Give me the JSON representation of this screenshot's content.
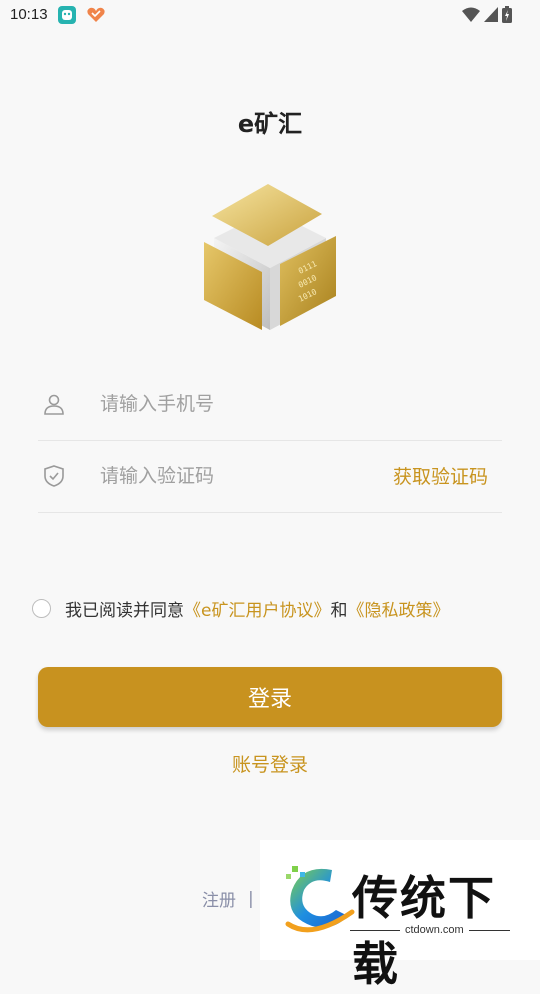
{
  "status_bar": {
    "time": "10:13",
    "icons": [
      "notification-app-icon",
      "heart-app-icon",
      "wifi-icon",
      "signal-icon",
      "battery-icon"
    ]
  },
  "header": {
    "title": "e矿汇"
  },
  "form": {
    "phone_placeholder": "请输入手机号",
    "code_placeholder": "请输入验证码",
    "get_code_label": "获取验证码"
  },
  "agreement": {
    "prefix": "我已阅读并同意",
    "user_agreement": "《e矿汇用户协议》",
    "conjunction": "和",
    "privacy_policy": "《隐私政策》"
  },
  "actions": {
    "login_label": "登录",
    "account_login_label": "账号登录"
  },
  "footer": {
    "register_label": "注册",
    "divider": "|"
  },
  "watermark": {
    "name": "传统下载",
    "url": "ctdown.com"
  },
  "colors": {
    "accent": "#c8921f",
    "link_gold": "#c8941f",
    "background": "#f8f8f8",
    "footer_link": "#8a8fa8"
  }
}
